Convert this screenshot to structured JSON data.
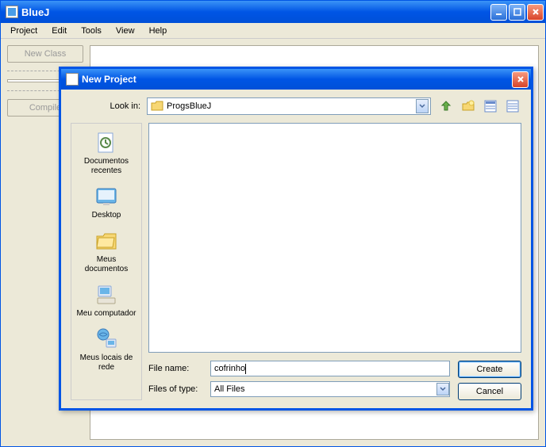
{
  "main": {
    "title": "BlueJ",
    "menus": [
      "Project",
      "Edit",
      "Tools",
      "View",
      "Help"
    ],
    "buttons": {
      "new_class": "New Class",
      "compile": "Compile"
    }
  },
  "dialog": {
    "title": "New Project",
    "look_in_label": "Look in:",
    "look_in_value": "ProgsBlueJ",
    "places": [
      {
        "label": "Documentos recentes"
      },
      {
        "label": "Desktop"
      },
      {
        "label": "Meus documentos"
      },
      {
        "label": "Meu computador"
      },
      {
        "label": "Meus locais de rede"
      }
    ],
    "file_name_label": "File name:",
    "file_name_value": "cofrinho",
    "files_type_label": "Files of type:",
    "files_type_value": "All Files",
    "create_btn": "Create",
    "cancel_btn": "Cancel",
    "toolbar_icons": [
      "up-icon",
      "new-folder-icon",
      "list-view-icon",
      "details-view-icon"
    ]
  }
}
